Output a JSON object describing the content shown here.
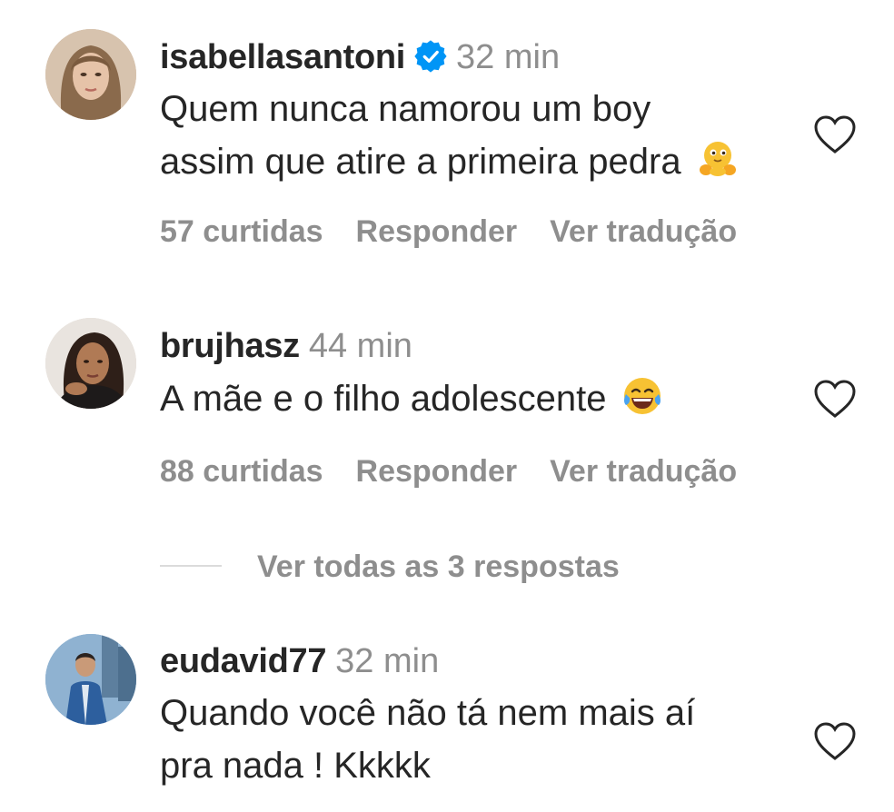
{
  "comments": [
    {
      "username": "isabellasantoni",
      "verified": true,
      "time": "32 min",
      "lines": [
        "Quem nunca namorou um boy",
        "assim que atire a primeira pedra"
      ],
      "emoji": "hugging-face-emoji",
      "likes": "57 curtidas",
      "reply": "Responder",
      "translate": "Ver tradução"
    },
    {
      "username": "brujhasz",
      "verified": false,
      "time": "44 min",
      "lines": [
        "A mãe e o filho adolescente"
      ],
      "emoji": "tears-of-joy-emoji",
      "likes": "88 curtidas",
      "reply": "Responder",
      "translate": "Ver tradução"
    },
    {
      "username": "eudavid77",
      "verified": false,
      "time": "32 min",
      "lines": [
        "Quando você não tá nem mais aí",
        "pra nada ! Kkkkk"
      ]
    }
  ],
  "view_replies": "Ver todas as 3 respostas",
  "colors": {
    "text": "#262626",
    "secondary": "#8e8e8e",
    "verified": "#0095f6",
    "divider": "#dbdbdb"
  }
}
